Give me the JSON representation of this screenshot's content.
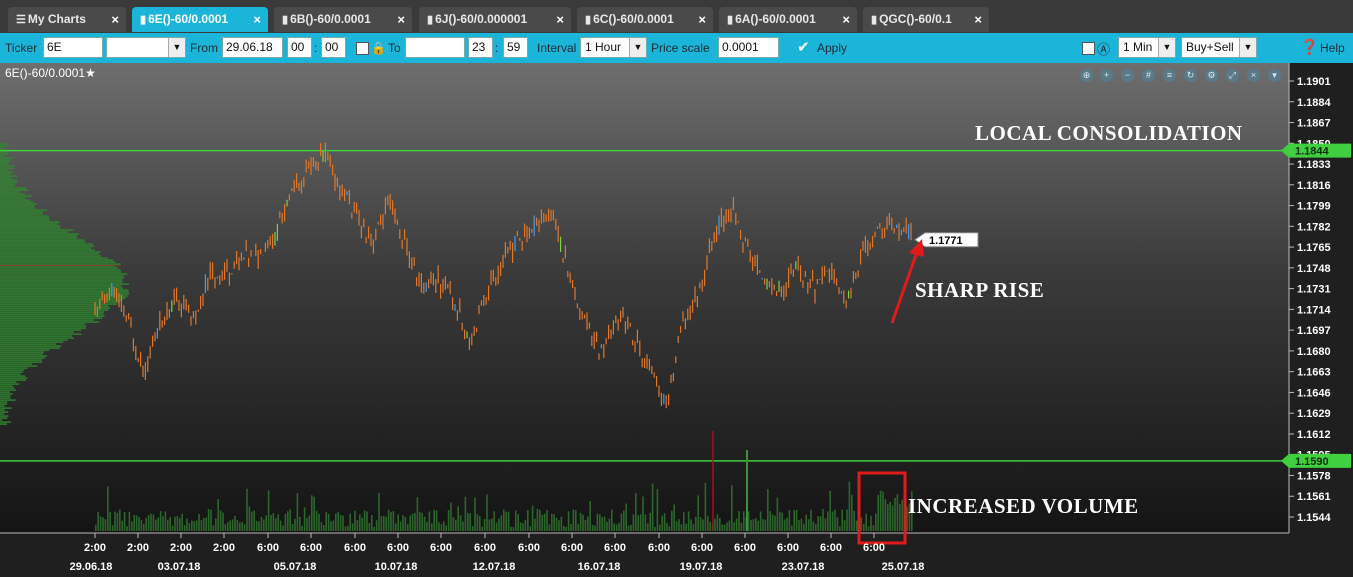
{
  "tabs": [
    {
      "label": "My Charts",
      "icon": "list-icon"
    },
    {
      "label": "6E()-60/0.0001",
      "icon": "bar-chart-icon"
    },
    {
      "label": "6B()-60/0.0001",
      "icon": "bar-chart-icon"
    },
    {
      "label": "6J()-60/0.000001",
      "icon": "bar-chart-icon"
    },
    {
      "label": "6C()-60/0.0001",
      "icon": "bar-chart-icon"
    },
    {
      "label": "6A()-60/0.0001",
      "icon": "bar-chart-icon"
    },
    {
      "label": "QGC()-60/0.1",
      "icon": "bar-chart-icon"
    }
  ],
  "toolbar": {
    "ticker_label": "Ticker",
    "ticker_value": "6E",
    "from_label": "From",
    "from_date": "29.06.18",
    "from_hour": "00",
    "from_min": "00",
    "to_label": "To",
    "to_date": "",
    "to_hour": "23",
    "to_min": "59",
    "interval_label": "Interval",
    "interval_value": "1 Hour",
    "price_scale_label": "Price scale",
    "price_scale_value": "0.0001",
    "apply_label": "Apply",
    "timeframe_value": "1 Min",
    "side_value": "Buy+Sell",
    "help_label": "Help"
  },
  "chart_title": "6E()-60/0.0001",
  "annotations": {
    "consolidation": "LOCAL CONSOLIDATION",
    "sharp_rise": "SHARP RISE",
    "volume": "INCREASED VOLUME"
  },
  "colors": {
    "accent": "#1ab5d8",
    "candle": "#e0782a",
    "level_line": "#3fcf3f",
    "profile": "#2e8b2e",
    "arrow": "#e01b1b"
  },
  "chart_data": {
    "type": "candlestick",
    "title": "6E()-60/0.0001",
    "y_ticks": [
      "1.1901",
      "1.1884",
      "1.1867",
      "1.1850",
      "1.1833",
      "1.1816",
      "1.1799",
      "1.1782",
      "1.1765",
      "1.1748",
      "1.1731",
      "1.1714",
      "1.1697",
      "1.1680",
      "1.1663",
      "1.1646",
      "1.1629",
      "1.1612",
      "1.1595",
      "1.1578",
      "1.1561",
      "1.1544"
    ],
    "ylim": [
      1.154,
      1.191
    ],
    "x_time_labels": [
      "2:00",
      "2:00",
      "2:00",
      "2:00",
      "6:00",
      "6:00",
      "6:00",
      "6:00",
      "6:00",
      "6:00",
      "6:00",
      "6:00",
      "6:00",
      "6:00",
      "6:00",
      "6:00",
      "6:00",
      "6:00",
      "6:00"
    ],
    "x_date_labels": [
      "29.06.18",
      "03.07.18",
      "05.07.18",
      "10.07.18",
      "12.07.18",
      "16.07.18",
      "19.07.18",
      "23.07.18",
      "25.07.18"
    ],
    "levels": [
      {
        "value": 1.1844,
        "label": "1.1844"
      },
      {
        "value": 1.159,
        "label": "1.1590"
      }
    ],
    "last_price": {
      "value": 1.1771,
      "label": "1.1771"
    },
    "price_path": [
      [
        0,
        1.171
      ],
      [
        0.02,
        1.173
      ],
      [
        0.04,
        1.1705
      ],
      [
        0.06,
        1.1665
      ],
      [
        0.08,
        1.17
      ],
      [
        0.1,
        1.1725
      ],
      [
        0.12,
        1.1705
      ],
      [
        0.14,
        1.174
      ],
      [
        0.16,
        1.1745
      ],
      [
        0.18,
        1.1755
      ],
      [
        0.2,
        1.176
      ],
      [
        0.22,
        1.1775
      ],
      [
        0.24,
        1.181
      ],
      [
        0.26,
        1.1825
      ],
      [
        0.28,
        1.184
      ],
      [
        0.3,
        1.1815
      ],
      [
        0.32,
        1.179
      ],
      [
        0.34,
        1.177
      ],
      [
        0.36,
        1.18
      ],
      [
        0.38,
        1.1765
      ],
      [
        0.4,
        1.173
      ],
      [
        0.42,
        1.174
      ],
      [
        0.44,
        1.172
      ],
      [
        0.46,
        1.169
      ],
      [
        0.48,
        1.173
      ],
      [
        0.5,
        1.1755
      ],
      [
        0.52,
        1.1775
      ],
      [
        0.54,
        1.178
      ],
      [
        0.56,
        1.179
      ],
      [
        0.58,
        1.1745
      ],
      [
        0.6,
        1.17
      ],
      [
        0.62,
        1.168
      ],
      [
        0.64,
        1.171
      ],
      [
        0.66,
        1.169
      ],
      [
        0.68,
        1.166
      ],
      [
        0.7,
        1.1635
      ],
      [
        0.72,
        1.1705
      ],
      [
        0.74,
        1.173
      ],
      [
        0.76,
        1.178
      ],
      [
        0.78,
        1.1795
      ],
      [
        0.8,
        1.176
      ],
      [
        0.82,
        1.174
      ],
      [
        0.84,
        1.1725
      ],
      [
        0.86,
        1.175
      ],
      [
        0.88,
        1.173
      ],
      [
        0.9,
        1.1745
      ],
      [
        0.92,
        1.172
      ],
      [
        0.94,
        1.176
      ],
      [
        0.96,
        1.1785
      ],
      [
        1.0,
        1.1775
      ]
    ],
    "volume_profile": true,
    "volume_series": true
  }
}
